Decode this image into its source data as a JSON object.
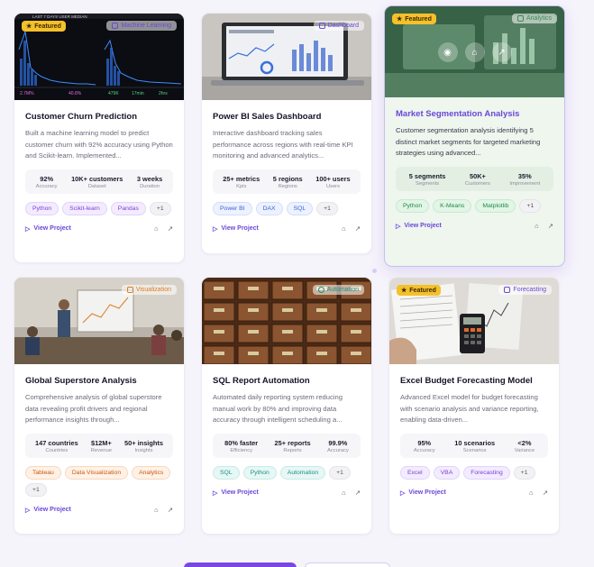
{
  "labels": {
    "featured": "Featured",
    "view_project": "View Project"
  },
  "cards": [
    {
      "title": "Customer Churn Prediction",
      "category": "Machine Learning",
      "featured": true,
      "description": "Built a machine learning model to predict customer churn with 92% accuracy using Python and Scikit-learn. Implemented...",
      "stats": [
        {
          "value": "92%",
          "label": "Accuracy"
        },
        {
          "value": "10K+ customers",
          "label": "Dataset"
        },
        {
          "value": "3 weeks",
          "label": "Duration"
        }
      ],
      "tags": [
        "Python",
        "Scikit-learn",
        "Pandas"
      ],
      "more": "+1",
      "thumb_text": {
        "banner": "LAST 7 DAYS USER MEDIAN",
        "stats": [
          "2.7M%",
          "40.8%",
          "479K",
          "17min",
          "2hrs"
        ]
      }
    },
    {
      "title": "Power BI Sales Dashboard",
      "category": "Dashboard",
      "featured": false,
      "description": "Interactive dashboard tracking sales performance across regions with real-time KPI monitoring and advanced analytics...",
      "stats": [
        {
          "value": "25+ metrics",
          "label": "Kpis"
        },
        {
          "value": "5 regions",
          "label": "Regions"
        },
        {
          "value": "100+ users",
          "label": "Users"
        }
      ],
      "tags": [
        "Power BI",
        "DAX",
        "SQL"
      ],
      "more": "+1"
    },
    {
      "title": "Market Segmentation Analysis",
      "category": "Analytics",
      "featured": true,
      "description": "Customer segmentation analysis identifying 5 distinct market segments for targeted marketing strategies using advanced...",
      "stats": [
        {
          "value": "5 segments",
          "label": "Segments"
        },
        {
          "value": "50K+",
          "label": "Customers"
        },
        {
          "value": "35%",
          "label": "Improvement"
        }
      ],
      "tags": [
        "Python",
        "K-Means",
        "Matplotlib"
      ],
      "more": "+1"
    },
    {
      "title": "Global Superstore Analysis",
      "category": "Visualization",
      "featured": false,
      "description": "Comprehensive analysis of global superstore data revealing profit drivers and regional performance insights through...",
      "stats": [
        {
          "value": "147 countries",
          "label": "Countries"
        },
        {
          "value": "$12M+",
          "label": "Revenue"
        },
        {
          "value": "50+ insights",
          "label": "Insights"
        }
      ],
      "tags": [
        "Tableau",
        "Data Visualization",
        "Analytics"
      ],
      "more": "+1"
    },
    {
      "title": "SQL Report Automation",
      "category": "Automation",
      "featured": false,
      "description": "Automated daily reporting system reducing manual work by 80% and improving data accuracy through intelligent scheduling a...",
      "stats": [
        {
          "value": "80% faster",
          "label": "Efficiency"
        },
        {
          "value": "25+ reports",
          "label": "Reports"
        },
        {
          "value": "99.9%",
          "label": "Accuracy"
        }
      ],
      "tags": [
        "SQL",
        "Python",
        "Automation"
      ],
      "more": "+1"
    },
    {
      "title": "Excel Budget Forecasting Model",
      "category": "Forecasting",
      "featured": true,
      "description": "Advanced Excel model for budget forecasting with scenario analysis and variance reporting, enabling data-driven...",
      "stats": [
        {
          "value": "95%",
          "label": "Accuracy"
        },
        {
          "value": "10 scenarios",
          "label": "Scenarios"
        },
        {
          "value": "<2%",
          "label": "Variance"
        }
      ],
      "tags": [
        "Excel",
        "VBA",
        "Forecasting"
      ],
      "more": "+1"
    }
  ],
  "colors": {
    "accent": "#6a48d8",
    "featured_badge": "#f5c02a",
    "highlight_card_bg": "#eef6ee",
    "page_bg": "#f6f4fb"
  }
}
